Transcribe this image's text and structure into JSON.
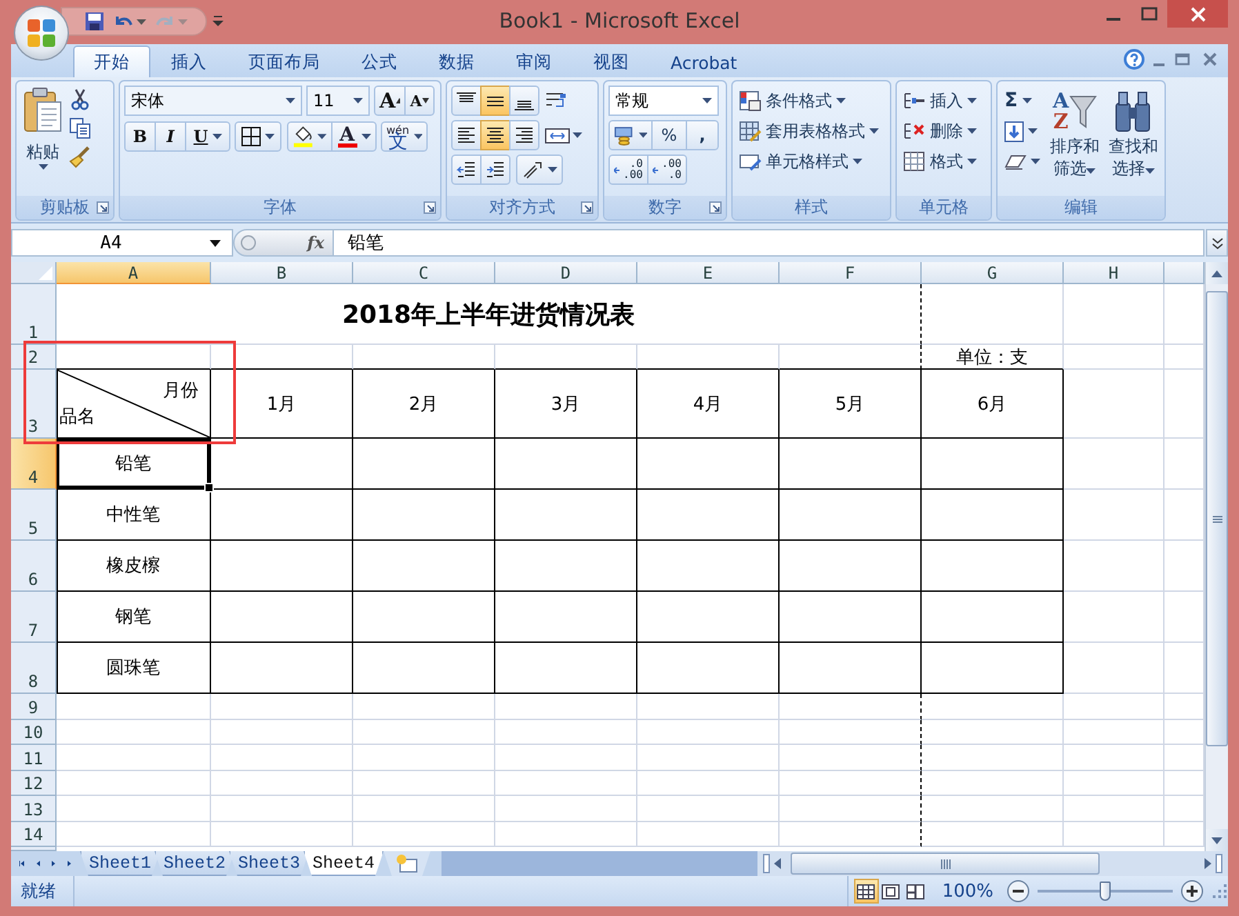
{
  "window": {
    "title": "Book1 - Microsoft Excel"
  },
  "ribbon": {
    "tabs": [
      {
        "label": "开始",
        "selected": true
      },
      {
        "label": "插入",
        "selected": false
      },
      {
        "label": "页面布局",
        "selected": false
      },
      {
        "label": "公式",
        "selected": false
      },
      {
        "label": "数据",
        "selected": false
      },
      {
        "label": "审阅",
        "selected": false
      },
      {
        "label": "视图",
        "selected": false
      },
      {
        "label": "Acrobat",
        "selected": false
      }
    ],
    "clipboard": {
      "title": "剪贴板",
      "paste": "粘贴"
    },
    "font": {
      "title": "字体",
      "font_name": "宋体",
      "font_size": "11",
      "grow": "A",
      "shrink": "A",
      "bold": "B",
      "italic": "I",
      "underline": "U",
      "font_color": "A",
      "phonetic_top": "wén",
      "phonetic_bottom": "文"
    },
    "alignment": {
      "title": "对齐方式",
      "vertical": [
        {
          "kind": "top",
          "selected": false
        },
        {
          "kind": "middle",
          "selected": true
        },
        {
          "kind": "bottom",
          "selected": false
        }
      ],
      "horizontal": [
        {
          "kind": "left",
          "selected": false
        },
        {
          "kind": "center",
          "selected": true
        },
        {
          "kind": "right",
          "selected": false
        }
      ]
    },
    "number": {
      "title": "数字",
      "format": "常规",
      "percent": "%",
      "comma": ",",
      "decimals": [
        {
          "top": ".0",
          "bottom": ".00"
        },
        {
          "top": ".00",
          "bottom": ".0"
        }
      ]
    },
    "styles": {
      "title": "样式",
      "items": [
        "条件格式",
        "套用表格格式",
        "单元格样式"
      ]
    },
    "cells": {
      "title": "单元格",
      "items": [
        "插入",
        "删除",
        "格式"
      ]
    },
    "editing": {
      "title": "编辑",
      "sum": "Σ",
      "sort_letters": [
        "A",
        "Z"
      ],
      "sort": [
        "排序和",
        "筛选"
      ],
      "find": [
        "查找和",
        "选择"
      ]
    }
  },
  "formula_bar": {
    "name_box": "A4",
    "fx": "fx",
    "value": "铅笔"
  },
  "sheet": {
    "columns": [
      {
        "label": "A",
        "selected": true
      },
      {
        "label": "B",
        "selected": false
      },
      {
        "label": "C",
        "selected": false
      },
      {
        "label": "D",
        "selected": false
      },
      {
        "label": "E",
        "selected": false
      },
      {
        "label": "F",
        "selected": false
      },
      {
        "label": "G",
        "selected": false
      },
      {
        "label": "H",
        "selected": false
      }
    ],
    "rows": [
      {
        "label": "1",
        "selected": false
      },
      {
        "label": "2",
        "selected": false
      },
      {
        "label": "3",
        "selected": false
      },
      {
        "label": "4",
        "selected": true
      },
      {
        "label": "5",
        "selected": false
      },
      {
        "label": "6",
        "selected": false
      },
      {
        "label": "7",
        "selected": false
      },
      {
        "label": "8",
        "selected": false
      },
      {
        "label": "9",
        "selected": false
      },
      {
        "label": "10",
        "selected": false
      },
      {
        "label": "11",
        "selected": false
      },
      {
        "label": "12",
        "selected": false
      },
      {
        "label": "13",
        "selected": false
      },
      {
        "label": "14",
        "selected": false
      }
    ],
    "title": "2018年上半年进货情况表",
    "unit": "单位：支",
    "corner_top": "月份",
    "corner_bottom": "品名",
    "months": [
      "1月",
      "2月",
      "3月",
      "4月",
      "5月",
      "6月"
    ],
    "items": [
      {
        "name": "铅笔",
        "selected": true
      },
      {
        "name": "中性笔",
        "selected": false
      },
      {
        "name": "橡皮檫",
        "selected": false
      },
      {
        "name": "钢笔",
        "selected": false
      },
      {
        "name": "圆珠笔",
        "selected": false
      }
    ]
  },
  "sheet_tabs": [
    {
      "label": "Sheet1",
      "selected": false
    },
    {
      "label": "Sheet2",
      "selected": false
    },
    {
      "label": "Sheet3",
      "selected": false
    },
    {
      "label": "Sheet4",
      "selected": true
    }
  ],
  "status_bar": {
    "status": "就绪",
    "views": [
      {
        "kind": "normal",
        "selected": true
      },
      {
        "kind": "page_layout",
        "selected": false
      },
      {
        "kind": "page_break",
        "selected": false
      }
    ],
    "zoom": "100%",
    "zoom_slider": {
      "level": 0.5
    }
  }
}
